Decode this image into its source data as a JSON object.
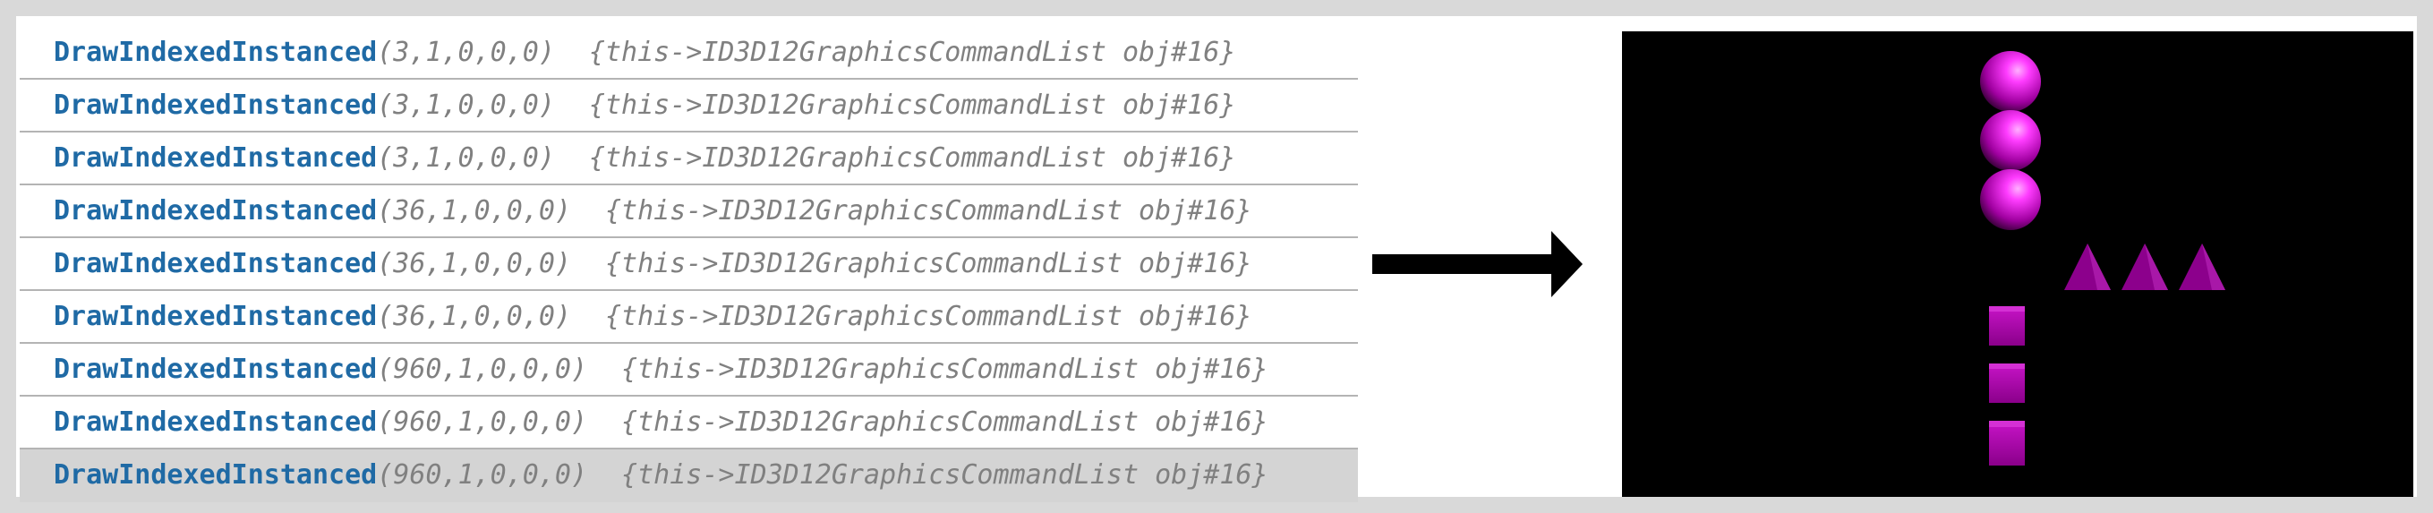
{
  "event_list": {
    "rows": [
      {
        "function": "DrawIndexedInstanced",
        "args": "(3,1,0,0,0)",
        "context": "{this->ID3D12GraphicsCommandList obj#16}"
      },
      {
        "function": "DrawIndexedInstanced",
        "args": "(3,1,0,0,0)",
        "context": "{this->ID3D12GraphicsCommandList obj#16}"
      },
      {
        "function": "DrawIndexedInstanced",
        "args": "(3,1,0,0,0)",
        "context": "{this->ID3D12GraphicsCommandList obj#16}"
      },
      {
        "function": "DrawIndexedInstanced",
        "args": "(36,1,0,0,0)",
        "context": "{this->ID3D12GraphicsCommandList obj#16}"
      },
      {
        "function": "DrawIndexedInstanced",
        "args": "(36,1,0,0,0)",
        "context": "{this->ID3D12GraphicsCommandList obj#16}"
      },
      {
        "function": "DrawIndexedInstanced",
        "args": "(36,1,0,0,0)",
        "context": "{this->ID3D12GraphicsCommandList obj#16}"
      },
      {
        "function": "DrawIndexedInstanced",
        "args": "(960,1,0,0,0)",
        "context": "{this->ID3D12GraphicsCommandList obj#16}"
      },
      {
        "function": "DrawIndexedInstanced",
        "args": "(960,1,0,0,0)",
        "context": "{this->ID3D12GraphicsCommandList obj#16}"
      },
      {
        "function": "DrawIndexedInstanced",
        "args": "(960,1,0,0,0)",
        "context": "{this->ID3D12GraphicsCommandList obj#16}"
      }
    ],
    "selected_index": 8
  },
  "arrow_icon": "right-arrow-icon",
  "render_preview": {
    "background_color": "#000000",
    "object_color": "#b000b0",
    "highlight_color": "#ff55ff",
    "spheres": 3,
    "pyramids": 3,
    "cubes": 3
  }
}
